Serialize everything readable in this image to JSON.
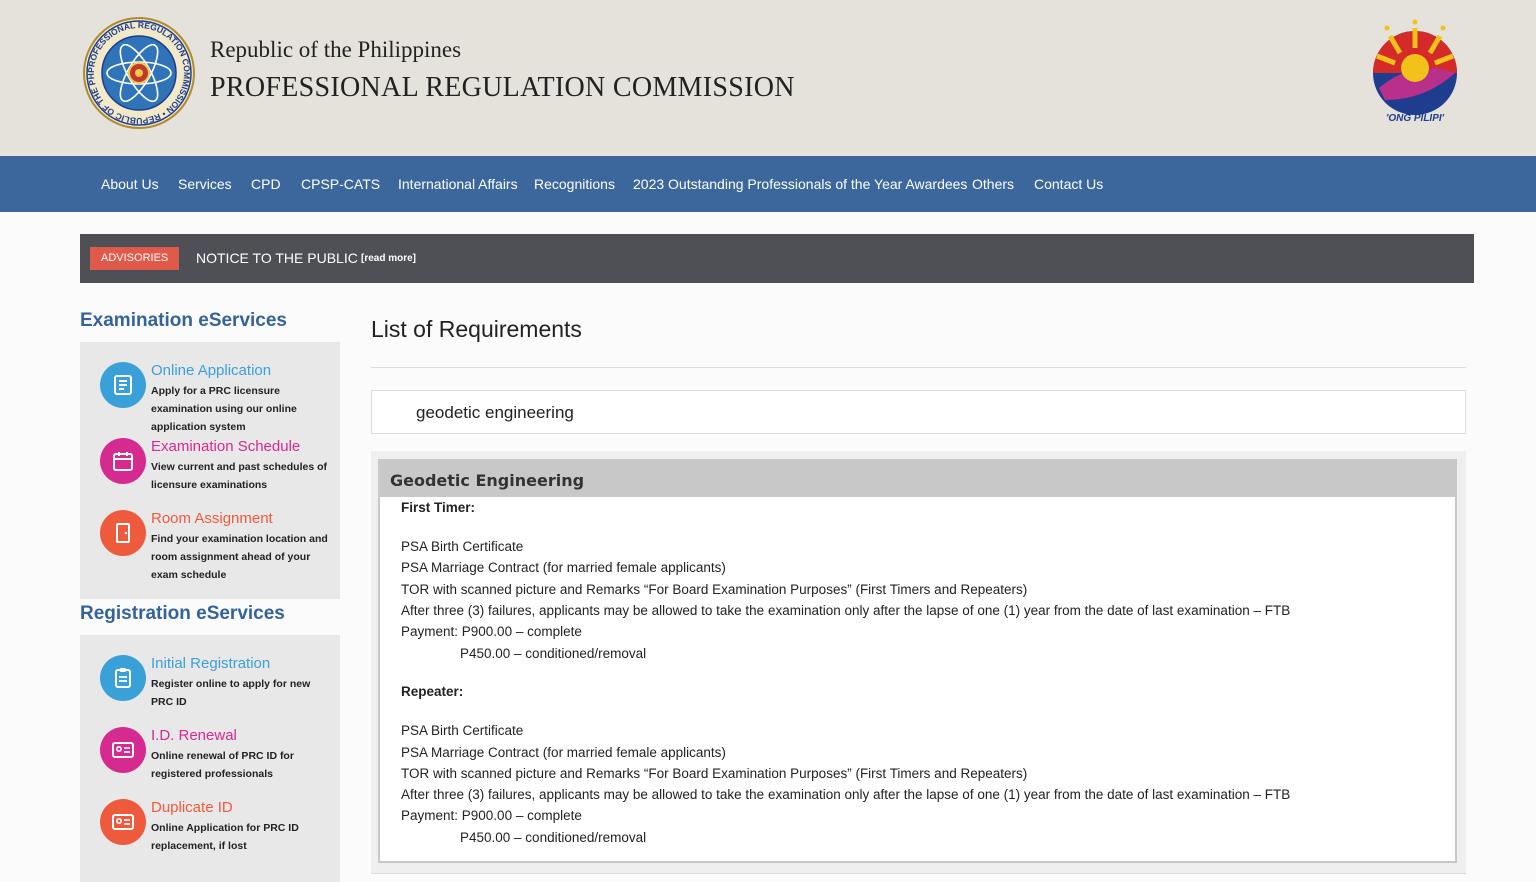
{
  "header": {
    "line1": "Republic of the Philippines",
    "line2": "PROFESSIONAL REGULATION COMMISSION",
    "seal_text": "PROFESSIONAL REGULATION COMMISSION • REPUBLIC OF THE PHILIPPINES •",
    "bp_text": "'ONG PILIPI'"
  },
  "nav": {
    "items": [
      "About Us",
      "Services",
      "CPD",
      "CPSP-CATS",
      "International Affairs",
      "Recognitions",
      "2023 Outstanding Professionals of the Year Awardees",
      "Others",
      "Contact Us"
    ]
  },
  "advisory": {
    "badge": "ADVISORIES",
    "notice": "NOTICE TO THE PUBLIC",
    "read_more": "[read more]"
  },
  "sidebar": {
    "exam_title": "Examination eServices",
    "exam_services": [
      {
        "title": "Online Application",
        "desc": "Apply for a PRC licensure examination using our online application system",
        "color": "#3aa0d8",
        "icon": "application-icon"
      },
      {
        "title": "Examination Schedule",
        "desc": "View current and past schedules of licensure examinations",
        "color": "#d52a8f",
        "icon": "calendar-icon"
      },
      {
        "title": "Room Assignment",
        "desc": "Find your examination location and room assignment ahead of your exam schedule",
        "color": "#ee5a3c",
        "icon": "door-icon"
      }
    ],
    "reg_title": "Registration eServices",
    "reg_services": [
      {
        "title": "Initial Registration",
        "desc": "Register online to apply for new PRC ID",
        "color": "#3aa0d8",
        "icon": "clipboard-icon"
      },
      {
        "title": "I.D. Renewal",
        "desc": "Online renewal of PRC ID for registered professionals",
        "color": "#d52a8f",
        "icon": "id-card-icon"
      },
      {
        "title": "Duplicate ID",
        "desc": "Online Application for PRC ID replacement, if lost",
        "color": "#ee5a3c",
        "icon": "id-card-icon"
      }
    ]
  },
  "main": {
    "title": "List of Requirements",
    "search_value": "geodetic engineering",
    "result_title": "Geodetic Engineering",
    "first_timer": {
      "label": "First Timer:",
      "items": [
        "PSA Birth Certificate",
        "PSA Marriage Contract (for married female applicants)",
        "TOR with scanned picture and Remarks “For Board Examination Purposes” (First Timers and Repeaters)",
        "After three (3) failures, applicants may be allowed to take the examination only after the lapse of one (1) year from the date of last examination – FTB",
        "Payment: P900.00 – complete",
        "P450.00 – conditioned/removal"
      ]
    },
    "repeater": {
      "label": "Repeater:",
      "items": [
        "PSA Birth Certificate",
        "PSA Marriage Contract (for married female applicants)",
        "TOR with scanned picture and Remarks “For Board Examination Purposes” (First Timers and Repeaters)",
        "After three (3) failures, applicants may be allowed to take the examination only after the lapse of one (1) year from the date of last examination – FTB",
        "Payment: P900.00 – complete",
        "P450.00 – conditioned/removal"
      ]
    }
  }
}
